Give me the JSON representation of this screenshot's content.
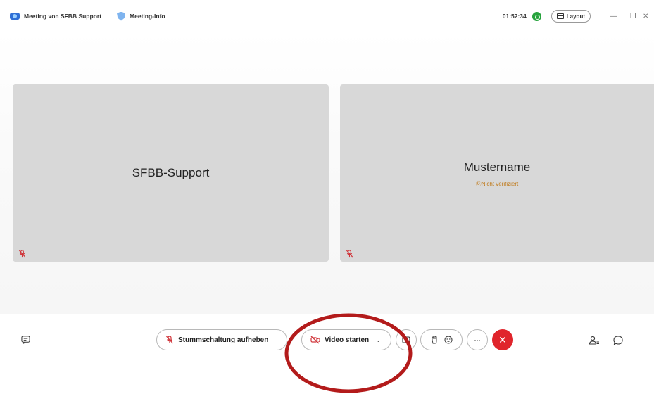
{
  "titlebar": {
    "meeting_title": "Meeting von SFBB Support",
    "meeting_info_label": "Meeting-Info",
    "timer": "01:52:34",
    "layout_label": "Layout",
    "minimize_glyph": "—",
    "restore_glyph": "❐",
    "close_glyph": "✕"
  },
  "participants": [
    {
      "name": "SFBB-Support",
      "status": ""
    },
    {
      "name": "Mustername",
      "status": "⓪Nicht verifiziert"
    }
  ],
  "controls": {
    "mute_label": "Stummschaltung aufheben",
    "video_label": "Video starten",
    "video_caret": "⌄",
    "more_glyph": "···",
    "end_glyph": "✕",
    "overflow_glyph": "···"
  },
  "icons": {
    "app": "webex-app-icon",
    "meeting_info": "shield-icon",
    "status": "connection-status-icon",
    "layout": "layout-icon",
    "mic": "mic-off-icon",
    "video": "video-off-icon",
    "share": "share-icon",
    "raise_hand": "raise-hand-icon",
    "reactions": "smiley-icon",
    "participants": "participants-icon",
    "chat": "chat-icon"
  },
  "colors": {
    "accent_status": "#27a33d",
    "end_call": "#e0252c",
    "muted_icon": "#d0353a",
    "warning_text": "#c07a1a",
    "annotation": "#b31b1b"
  }
}
